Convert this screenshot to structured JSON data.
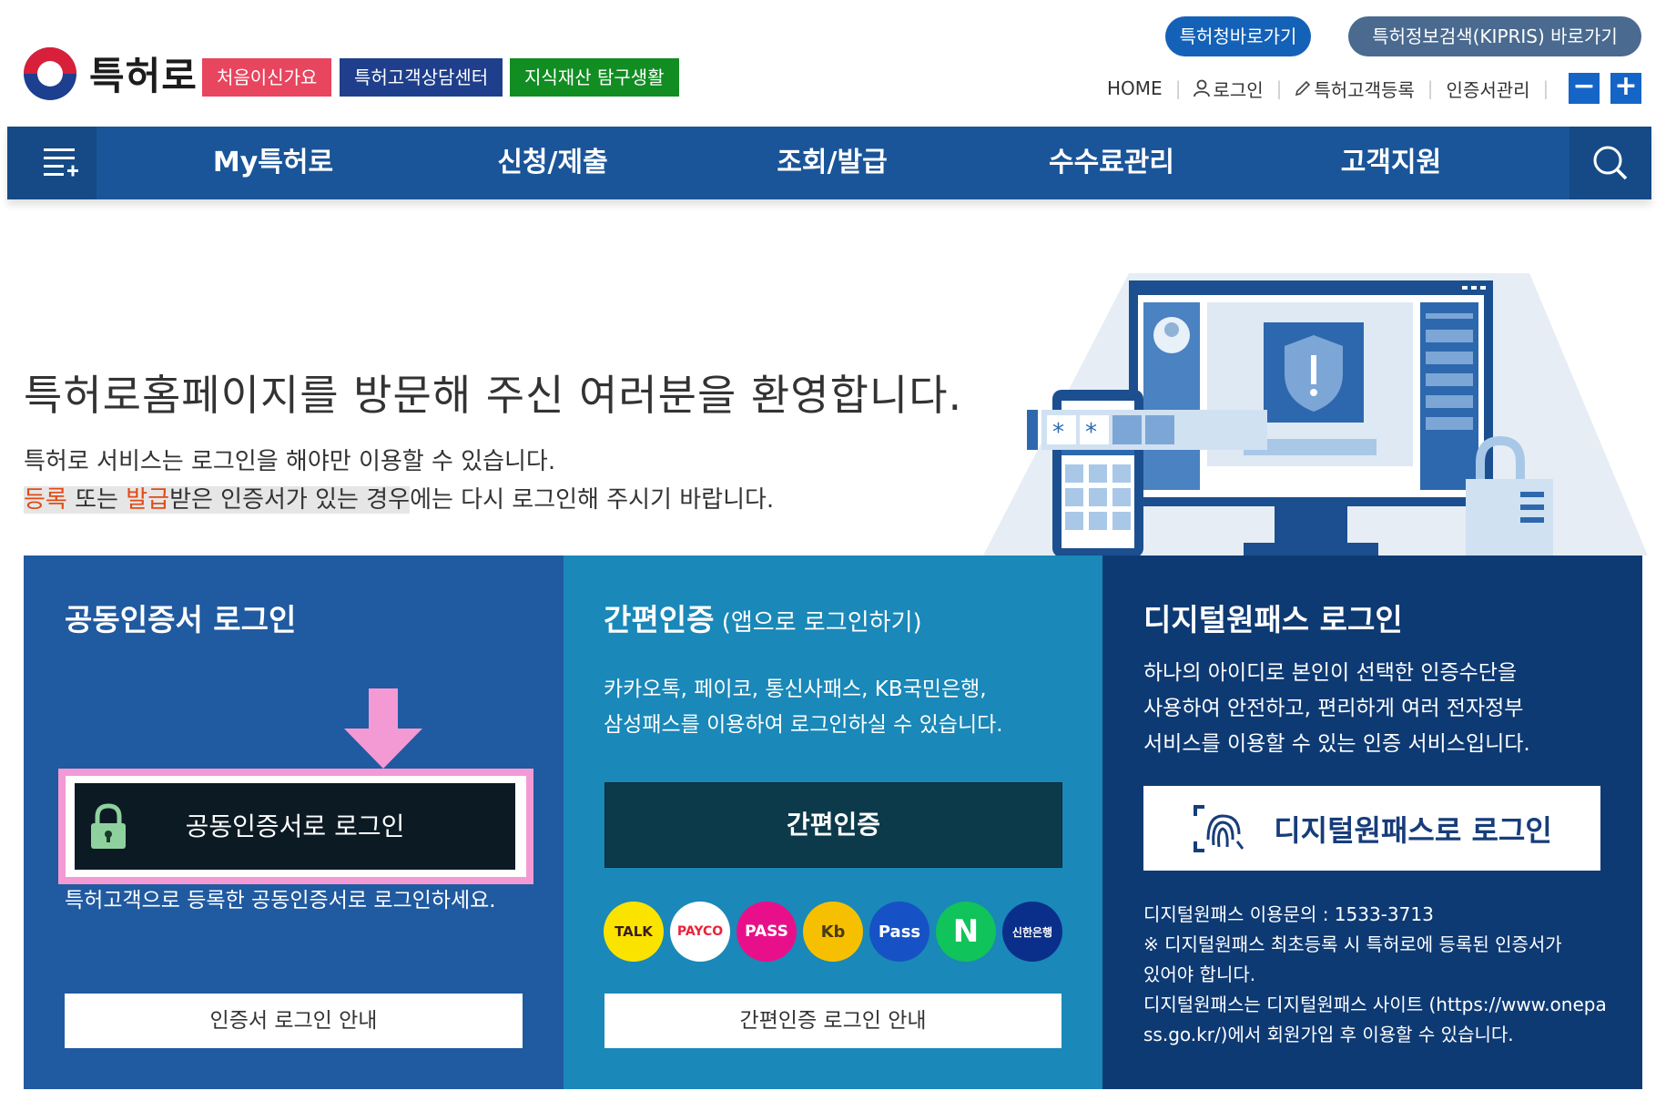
{
  "header": {
    "logo_text": "특허로",
    "tags": [
      "처음이신가요",
      "특허고객상담센터",
      "지식재산 탐구생활"
    ],
    "pills": [
      "특허청바로가기",
      "특허정보검색(KIPRIS) 바로가기"
    ],
    "util": {
      "home": "HOME",
      "login": "로그인",
      "register": "특허고객등록",
      "cert": "인증서관리"
    },
    "zoom_out": "−",
    "zoom_in": "+"
  },
  "nav": {
    "items": [
      "My특허로",
      "신청/제출",
      "조회/발급",
      "수수료관리",
      "고객지원"
    ]
  },
  "hero": {
    "title": "특허로홈페이지를 방문해 주신 여러분을 환영합니다.",
    "line1": "특허로 서비스는 로그인을 해야만 이용할 수 있습니다.",
    "line2_a": "등록",
    "line2_b": " 또는 ",
    "line2_c": "발급",
    "line2_d": "받은 인증서가 있는 경우",
    "line2_e": "에는 다시 로그인해 주시기 바랍니다."
  },
  "panel_cert": {
    "title": "공동인증서 로그인",
    "button": "공동인증서로 로그인",
    "note": "특허고객으로 등록한 공동인증서로 로그인하세요.",
    "guide": "인증서 로그인 안내"
  },
  "panel_easy": {
    "title": "간편인증",
    "title_sub": " (앱으로 로그인하기)",
    "desc1": "카카오톡, 페이코, 통신사패스, KB국민은행,",
    "desc2": "삼성패스를 이용하여 로그인하실 수 있습니다.",
    "button": "간편인증",
    "apps": [
      "TALK",
      "PAYCO",
      "PASS",
      "Kb",
      "Pass",
      "N",
      "신한은행"
    ],
    "guide": "간편인증 로그인 안내"
  },
  "panel_dop": {
    "title": "디지털원패스 로그인",
    "desc1": "하나의 아이디로 본인이 선택한 인증수단을",
    "desc2": "사용하여 안전하고, 편리하게 여러 전자정부",
    "desc3": "서비스를 이용할 수 있는 인증 서비스입니다.",
    "button": "디지털원패스로 로그인",
    "info1": "디지털원패스 이용문의 : 1533-3713",
    "info2": "※ 디지털원패스 최초등록 시 특허로에 등록된 인증서가",
    "info3": "있어야 합니다.",
    "info4": "디지털원패스는 디지털원패스 사이트 (https://www.onepa",
    "info5": "ss.go.kr/)에서 회원가입 후 이용할 수 있습니다."
  },
  "colors": {
    "nav": "#1a5599",
    "panel1": "#205aa0",
    "panel2": "#1a88b8",
    "panel3": "#0e3a74",
    "highlight": "#f39ad4"
  }
}
